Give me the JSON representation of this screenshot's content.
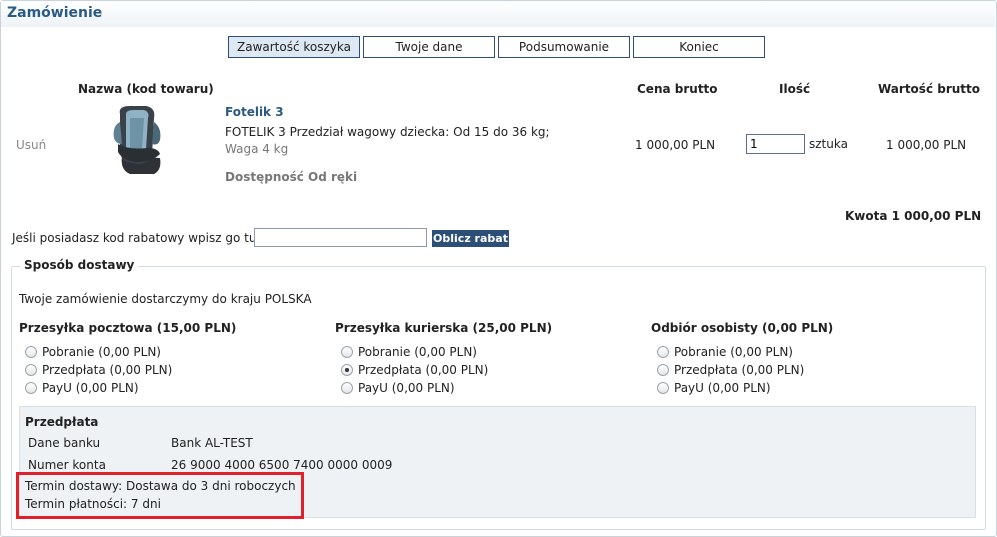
{
  "header": {
    "title": "Zamówienie"
  },
  "steps": [
    {
      "label": "Zawartość koszyka"
    },
    {
      "label": "Twoje dane"
    },
    {
      "label": "Podsumowanie"
    },
    {
      "label": "Koniec"
    }
  ],
  "table": {
    "headers": {
      "name": "Nazwa (kod towaru)",
      "price": "Cena brutto",
      "qty": "Ilość",
      "value": "Wartość brutto"
    },
    "row": {
      "remove": "Usuń",
      "product_name": "Fotelik 3",
      "description": "FOTELIK 3 Przedział wagowy dziecka: Od 15 do 36 kg;",
      "weight": "Waga 4 kg",
      "availability": "Dostępność Od ręki",
      "price": "1 000,00 PLN",
      "qty_value": "1",
      "unit": "sztuka",
      "value": "1 000,00 PLN"
    },
    "total": "Kwota 1 000,00 PLN"
  },
  "discount": {
    "label": "Jeśli posiadasz kod rabatowy wpisz go tutaj",
    "button": "Oblicz rabat"
  },
  "delivery": {
    "legend": "Sposób dostawy",
    "country_text": "Twoje zamówienie dostarczymy do kraju POLSKA",
    "groups": [
      {
        "title": "Przesyłka pocztowa (15,00 PLN)",
        "options": [
          "Pobranie (0,00 PLN)",
          "Przedpłata (0,00 PLN)",
          "PayU (0,00 PLN)"
        ]
      },
      {
        "title": "Przesyłka kurierska (25,00 PLN)",
        "options": [
          "Pobranie (0,00 PLN)",
          "Przedpłata (0,00 PLN)",
          "PayU (0,00 PLN)"
        ]
      },
      {
        "title": "Odbiór osobisty (0,00 PLN)",
        "options": [
          "Pobranie (0,00 PLN)",
          "Przedpłata (0,00 PLN)",
          "PayU (0,00 PLN)"
        ]
      }
    ],
    "selected": "Przesyłka kurierska / Przedpłata"
  },
  "payment_info": {
    "title": "Przedpłata",
    "bank_label": "Dane banku",
    "bank_value": "Bank AL-TEST",
    "account_label": "Numer konta",
    "account_value": "26 9000 4000 6500 7400 0000 0009",
    "delivery_term": "Termin dostawy: Dostawa do 3 dni roboczych",
    "payment_term": "Termin płatności: 7 dni"
  },
  "colors": {
    "accent": "#2b5a82",
    "button": "#2c4f78",
    "highlight": "#e0212b"
  }
}
